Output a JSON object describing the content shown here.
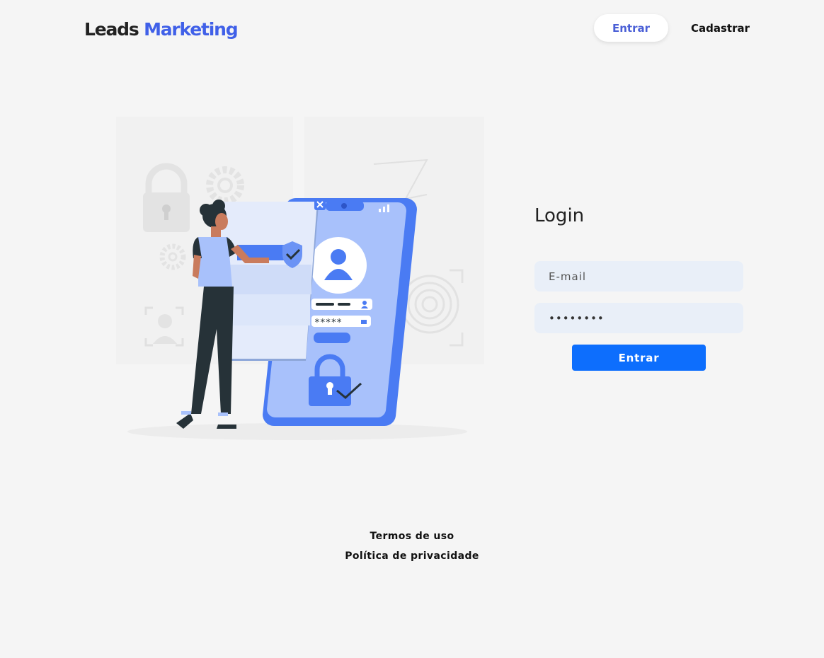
{
  "header": {
    "logo_primary": "Leads",
    "logo_accent": "Marketing",
    "nav_enter_label": "Entrar",
    "nav_register_label": "Cadastrar"
  },
  "login": {
    "title": "Login",
    "email_placeholder": "E-mail",
    "password_value": "password",
    "submit_label": "Entrar"
  },
  "footer": {
    "terms_label": "Termos de uso",
    "privacy_label": "Política de privacidade"
  },
  "illustration": {
    "icons": [
      "lock-icon",
      "gear-icon",
      "face-id-icon",
      "fingerprint-icon",
      "user-avatar-icon",
      "shield-check-icon",
      "padlock-check-icon",
      "close-icon"
    ],
    "password_mask": "*****"
  },
  "colors": {
    "background": "#f5f5f5",
    "brand_accent": "#4060e8",
    "primary_button": "#0d6efd",
    "input_background": "#e9eff8",
    "illustration_blue": "#4a7bf3",
    "illustration_light_blue": "#a8c1fb"
  }
}
